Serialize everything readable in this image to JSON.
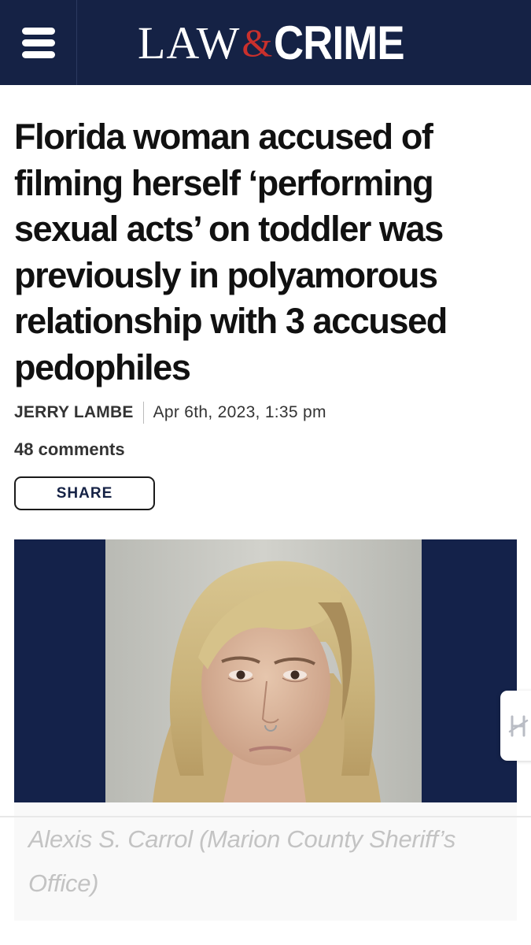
{
  "header": {
    "logo_law": "LAW",
    "logo_amp": "&",
    "logo_crime": "CRIME",
    "menu_icon": "hamburger-menu-icon",
    "brand_color": "#152245",
    "accent_color": "#c9302c"
  },
  "article": {
    "headline": "Florida woman accused of filming herself ‘performing sexual acts’ on toddler was previously in polyamorous relationship with 3 accused pedophiles",
    "author": "JERRY LAMBE",
    "date": "Apr 6th, 2023, 1:35 pm",
    "comments": "48 comments",
    "share_label": "SHARE"
  },
  "image": {
    "caption": "Alexis S. Carrol (Marion County Sheriff’s Office)"
  },
  "side_tab": {
    "icon": "highlighter-icon"
  }
}
